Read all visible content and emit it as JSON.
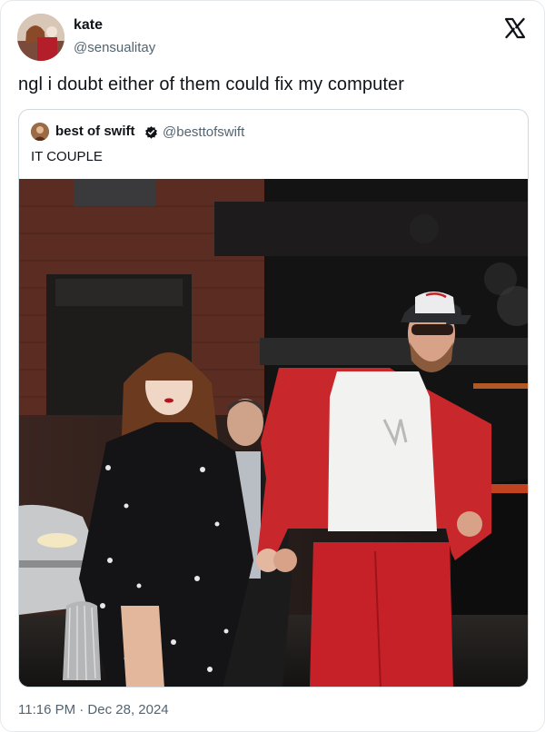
{
  "author": {
    "display_name": "kate",
    "handle": "@sensualitay",
    "avatar_icon": "profile-avatar"
  },
  "header": {
    "close_icon": "x-logo-icon"
  },
  "tweet": {
    "text": "ngl i doubt either of them could fix my computer",
    "timestamp": "11:16 PM · Dec 28, 2024"
  },
  "quote": {
    "display_name": "best of swift",
    "badge_icon": "verified-badge-icon",
    "handle": "@besttofswift",
    "text": "IT COUPLE",
    "photo_icon": "couple-photo"
  },
  "colors": {
    "text_primary": "#0f1419",
    "text_secondary": "#536471",
    "border": "#cfd9de",
    "jacket_red": "#c8282c"
  }
}
